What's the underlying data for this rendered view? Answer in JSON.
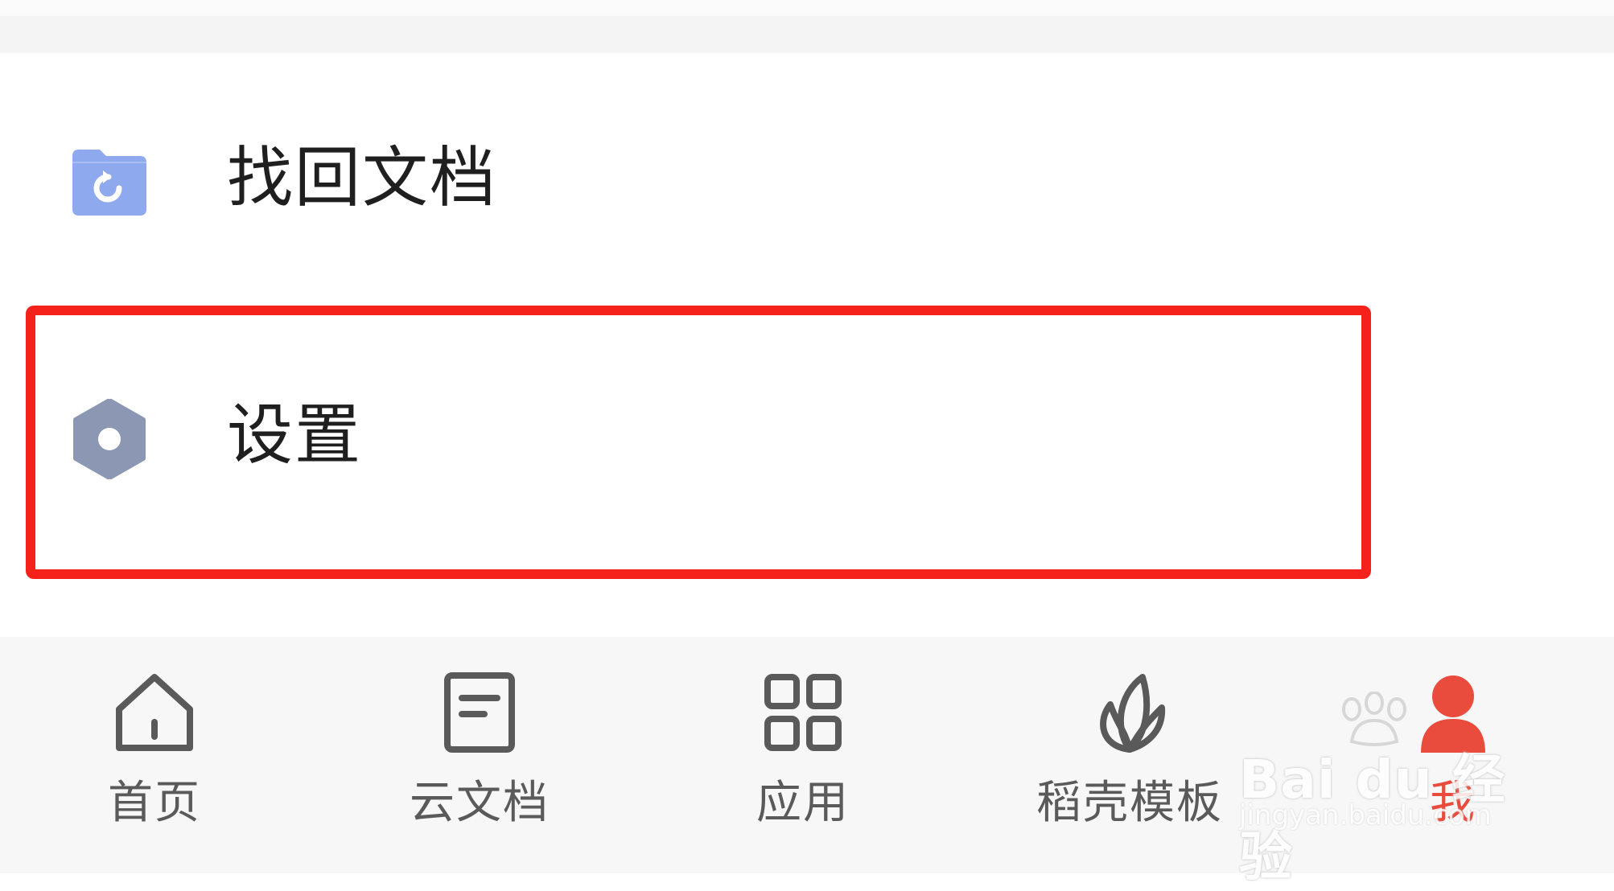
{
  "menu": {
    "items": [
      {
        "label": "找回文档",
        "icon": "folder-restore-icon",
        "icon_color": "#8fa9ef"
      },
      {
        "label": "设置",
        "icon": "hexagon-settings-icon",
        "icon_color": "#8c97b3"
      }
    ]
  },
  "highlight": {
    "color": "#f5211b"
  },
  "bottom_nav": {
    "items": [
      {
        "label": "首页",
        "icon": "home-icon"
      },
      {
        "label": "云文档",
        "icon": "document-icon"
      },
      {
        "label": "应用",
        "icon": "apps-grid-icon"
      },
      {
        "label": "稻壳模板",
        "icon": "leaf-icon"
      },
      {
        "label": "我",
        "icon": "person-icon",
        "active": true
      }
    ],
    "active_color": "#e94c3c",
    "inactive_color": "#5a5a5a"
  },
  "watermark": {
    "text": "Bai du 经验",
    "subtext": "jingyan.baidu.com"
  }
}
